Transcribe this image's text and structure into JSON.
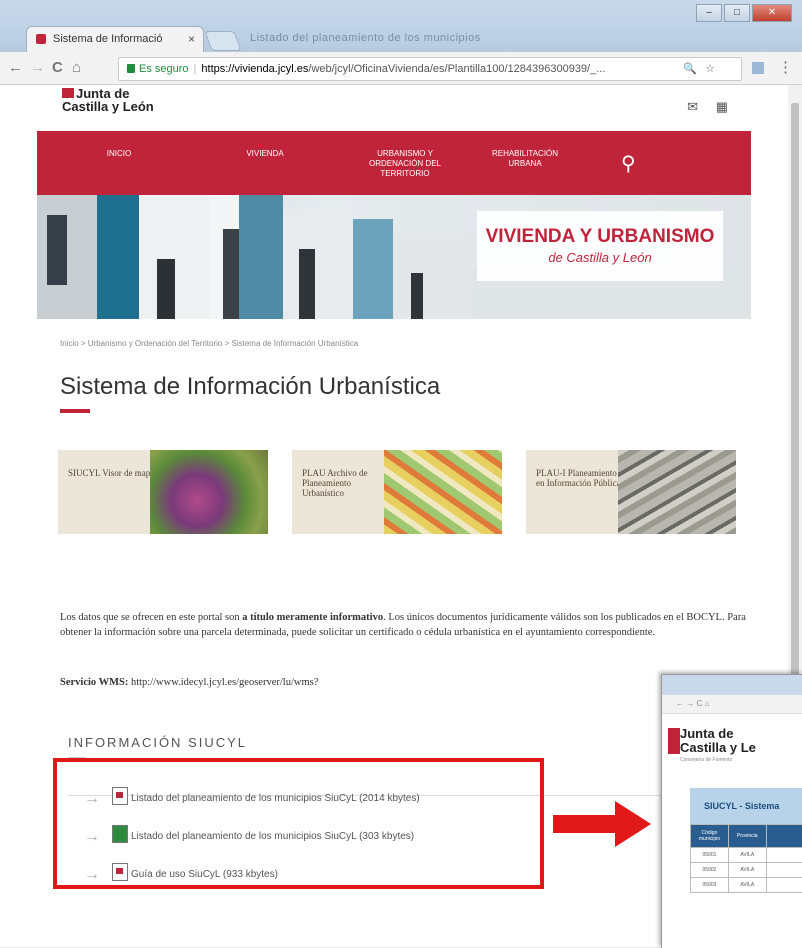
{
  "browser": {
    "tab_title": "Sistema de Informació",
    "tab_close": "×",
    "blurred_title": "Listado del planeamiento de los municipios",
    "secure_label": "Es seguro",
    "url_host": "https://vivienda.jcyl.es",
    "url_path": "/web/jcyl/OficinaVivienda/es/Plantilla100/1284396300939/_...",
    "nav_back": "←",
    "nav_forward": "→",
    "nav_reload": "C",
    "nav_home": "⌂",
    "zoom_icon": "🔍",
    "star_icon": "☆",
    "menu_icon": "⋮"
  },
  "site": {
    "logo_line1": "Junta de",
    "logo_line2": "Castilla y León",
    "mail_icon": "✉",
    "grid_icon": "▦",
    "menu": [
      {
        "label": "INICIO"
      },
      {
        "label": "VIVIENDA"
      },
      {
        "label": "URBANISMO Y ORDENACIÓN DEL TERRITORIO"
      },
      {
        "label": "REHABILITACIÓN URBANA"
      }
    ],
    "search_icon": "🔍",
    "hero_title": "VIVIENDA Y URBANISMO",
    "hero_subtitle": "de Castilla y León",
    "breadcrumb": "Inicio  >  Urbanismo y Ordenación del Territorio  >  Sistema de Información Urbanística",
    "page_title": "Sistema de Información Urbanística",
    "cards": [
      {
        "label": "SIUCYL Visor de mapas"
      },
      {
        "label": "PLAU Archivo de Planeamiento Urbanístico"
      },
      {
        "label": "PLAU-I Planeamiento en Información Pública"
      }
    ],
    "para_prefix": "Los datos que se ofrecen en este portal son ",
    "para_bold": "a título meramente informativo",
    "para_rest": ". Los únicos documentos jurídicamente válidos son los publicados en el BOCYL. Para obtener la información sobre una parcela determinada, puede solicitar un certificado o cédula urbanística en el ayuntamiento correspondiente.",
    "wms_label": "Servicio WMS:",
    "wms_url": " http://www.idecyl.jcyl.es/geoserver/lu/wms?",
    "section_title": "INFORMACIÓN SIUCYL",
    "downloads": [
      {
        "label": "Listado del planeamiento de los municipios SiuCyL (2014 kbytes)"
      },
      {
        "label": "Listado del planeamiento de los municipios SiuCyL (303 kbytes)"
      },
      {
        "label": "Guía de uso SiuCyL (933 kbytes)"
      }
    ],
    "arrow_glyph": "→"
  },
  "overlay": {
    "logo_line1": "Junta de",
    "logo_line2": "Castilla y Le",
    "sub": "Consejería de Fomento",
    "header": "SIUCYL - Sistema",
    "columns": [
      "Código municipio",
      "Provincia",
      ""
    ],
    "rows": [
      [
        "05001",
        "AVILA",
        ""
      ],
      [
        "05002",
        "AVILA",
        ""
      ],
      [
        "05003",
        "AVILA",
        ""
      ]
    ]
  },
  "colors": {
    "brand_red": "#c0243a",
    "highlight": "#e01818"
  }
}
